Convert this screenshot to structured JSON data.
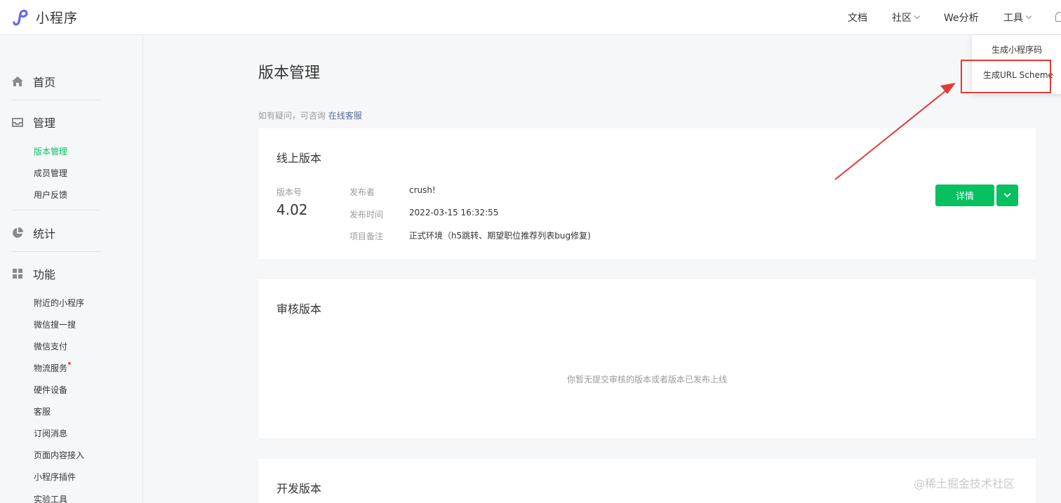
{
  "header": {
    "brand": "小程序",
    "nav": [
      {
        "label": "文档",
        "has_caret": false
      },
      {
        "label": "社区",
        "has_caret": true
      },
      {
        "label": "We分析",
        "has_caret": false
      },
      {
        "label": "工具",
        "has_caret": true
      }
    ]
  },
  "tools_menu": {
    "items": [
      "生成小程序码",
      "生成URL Scheme"
    ],
    "highlighted": "生成URL Scheme",
    "highlight_color": "#e53935"
  },
  "sidebar": {
    "home": {
      "label": "首页",
      "icon": "home-icon"
    },
    "manage": {
      "label": "管理",
      "icon": "inbox-icon",
      "items": [
        "版本管理",
        "成员管理",
        "用户反馈"
      ],
      "active": "版本管理"
    },
    "stats": {
      "label": "统计",
      "icon": "pie-chart-icon"
    },
    "features": {
      "label": "功能",
      "icon": "grid-icon",
      "items": [
        "附近的小程序",
        "微信搜一搜",
        "微信支付",
        "物流服务",
        "硬件设备",
        "客服",
        "订阅消息",
        "页面内容接入",
        "小程序插件",
        "实验工具"
      ],
      "badge_item": "物流服务"
    }
  },
  "main": {
    "title": "版本管理",
    "help_prefix": "如有疑问，可咨询",
    "help_link": "在线客服",
    "online": {
      "title": "线上版本",
      "version_label": "版本号",
      "version": "4.02",
      "publisher_label": "发布者",
      "publisher": "crush!",
      "time_label": "发布时间",
      "time": "2022-03-15 16:32:55",
      "note_label": "项目备注",
      "note": "正式环境（h5跳转、期望职位推荐列表bug修复)",
      "detail_button": "详情"
    },
    "review": {
      "title": "审核版本",
      "empty_text": "你暂无提交审核的版本或者版本已发布上线"
    },
    "dev": {
      "title": "开发版本"
    }
  },
  "watermark": "@稀土掘金技术社区",
  "colors": {
    "accent": "#07c160",
    "link": "#576b95",
    "annotation": "#e53935"
  }
}
